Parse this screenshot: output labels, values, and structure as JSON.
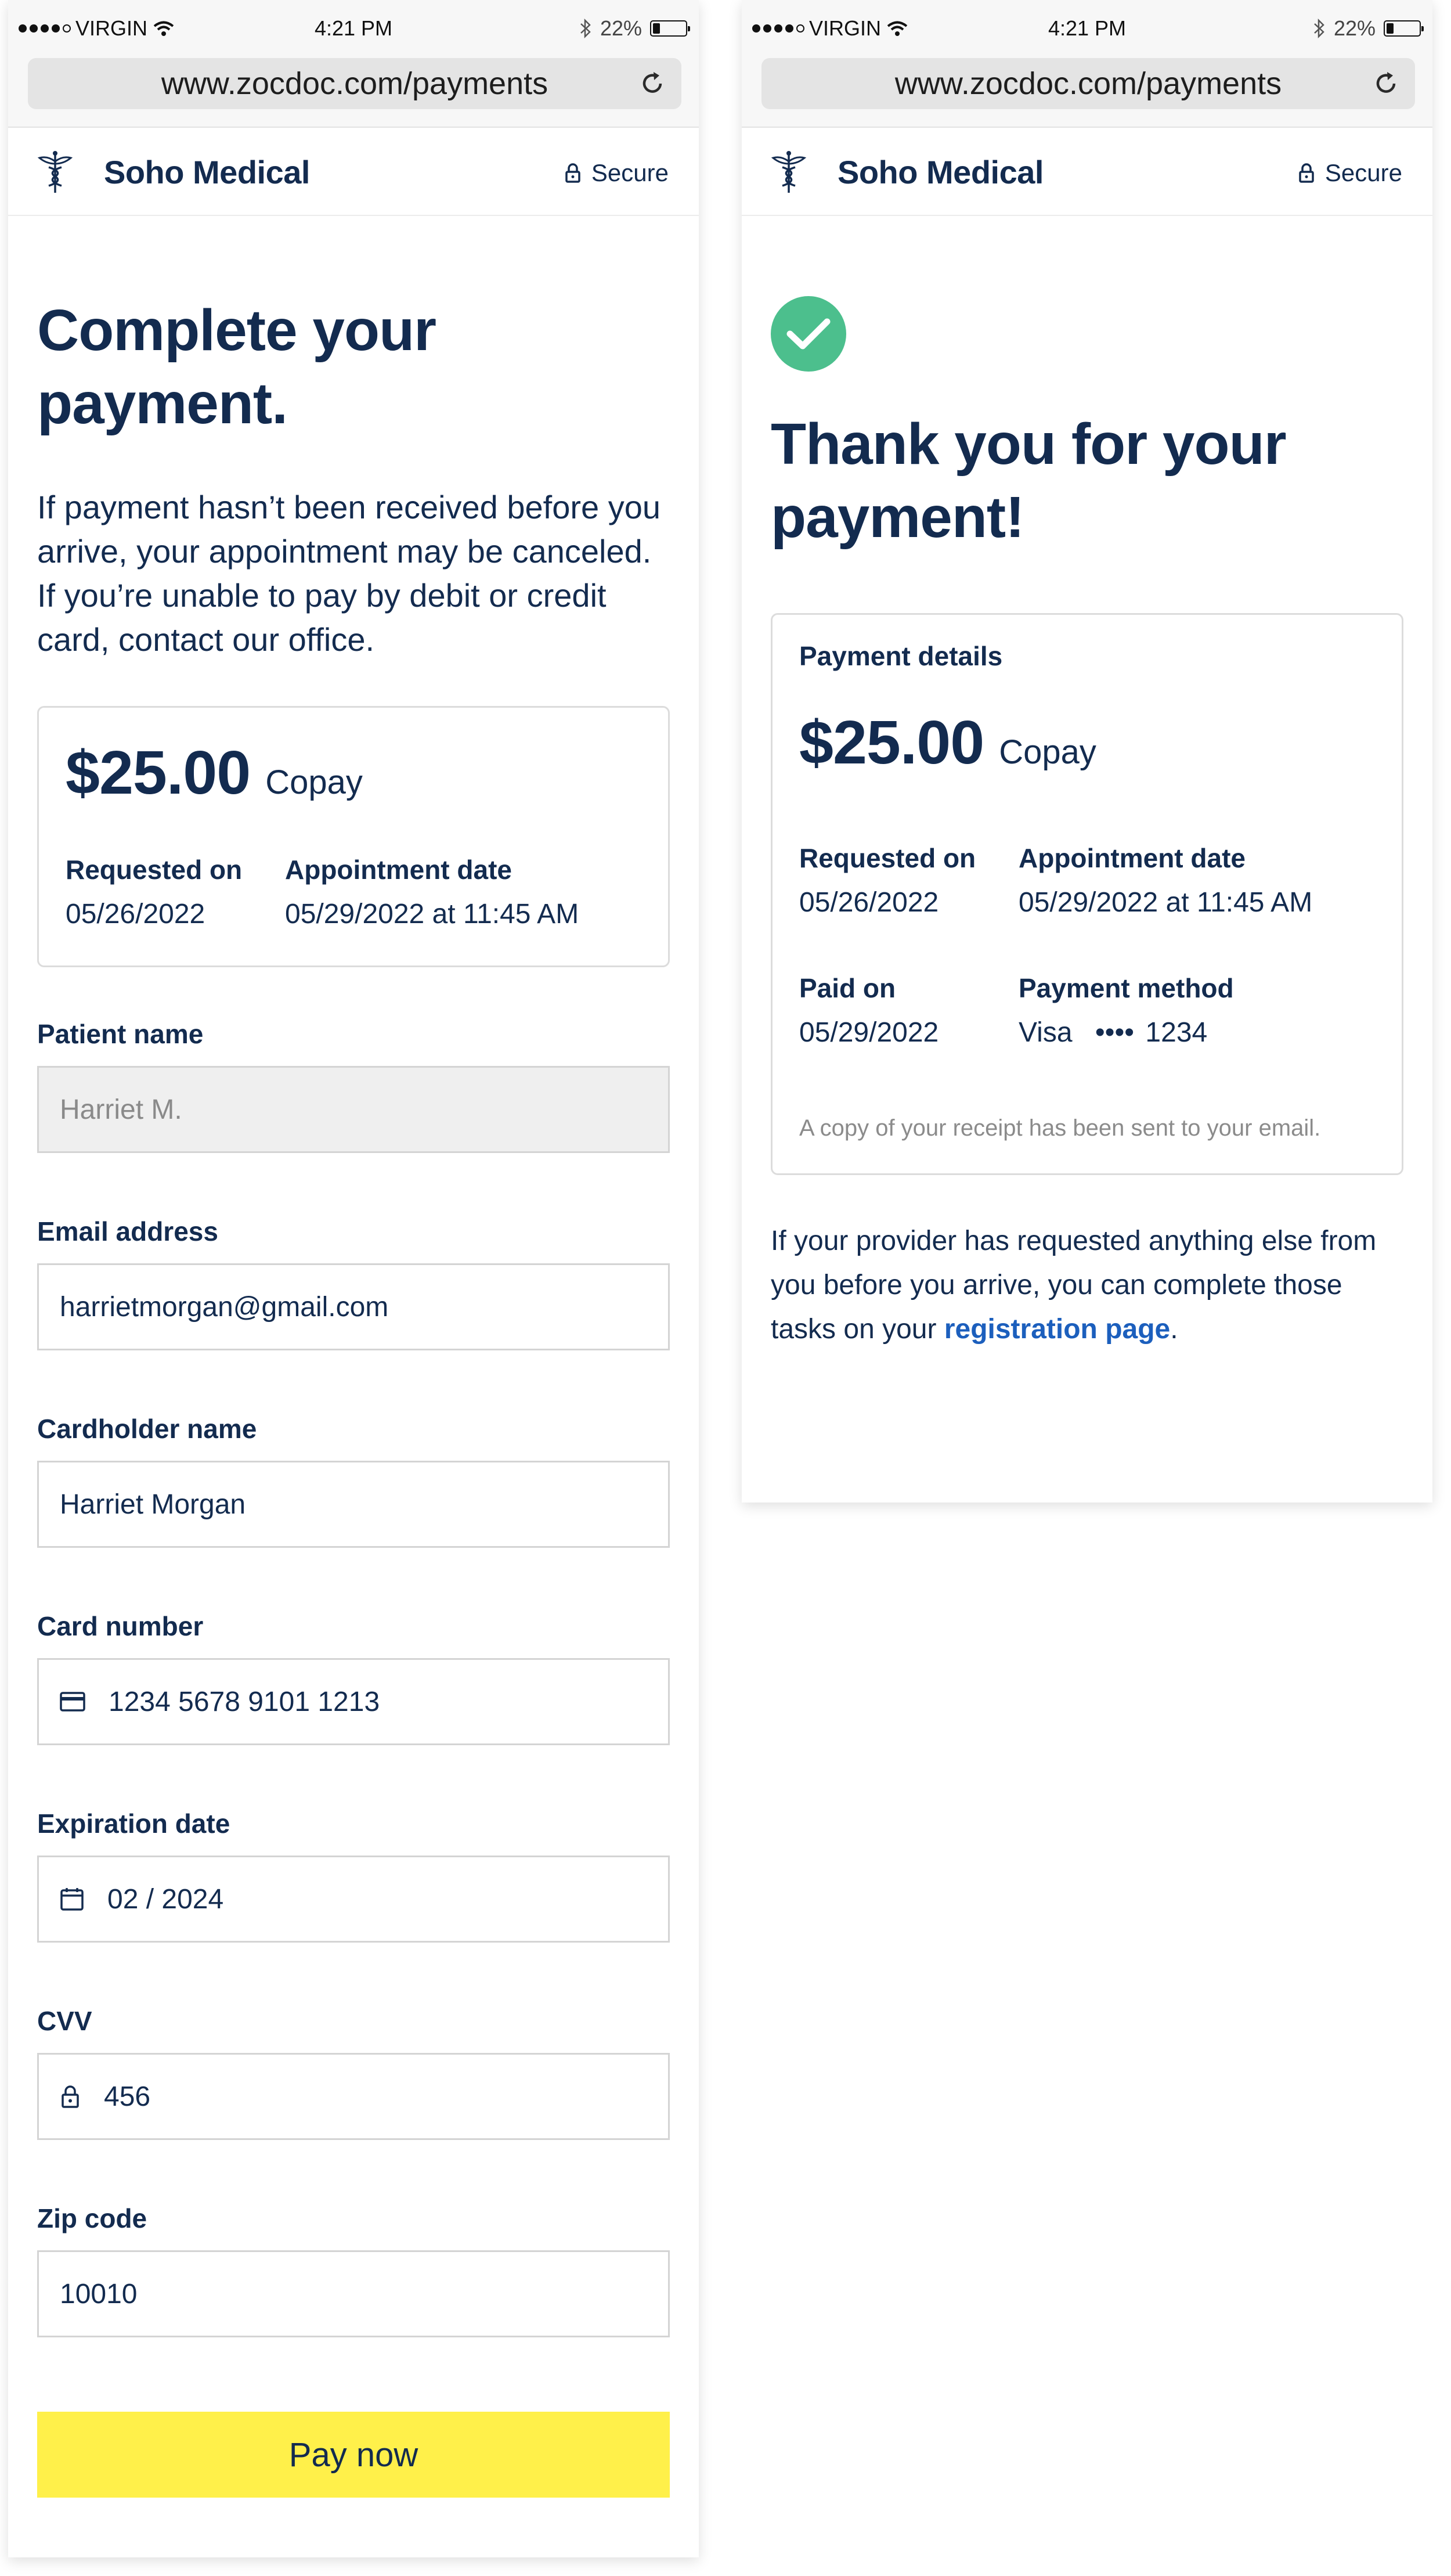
{
  "status_bar": {
    "carrier": "VIRGIN",
    "time": "4:21 PM",
    "battery": "22%"
  },
  "browser": {
    "url": "www.zocdoc.com/payments"
  },
  "header": {
    "brand": "Soho Medical",
    "secure_label": "Secure"
  },
  "payment_form": {
    "title": "Complete your payment.",
    "intro": "If payment hasn’t been received before you arrive, your appointment may be canceled. If you’re unable to pay by debit or credit card, contact our office.",
    "summary": {
      "amount": "$25.00",
      "amount_type": "Copay",
      "requested_label": "Requested on",
      "requested_value": "05/26/2022",
      "appointment_label": "Appointment date",
      "appointment_value": "05/29/2022 at 11:45 AM"
    },
    "fields": {
      "patient_name": {
        "label": "Patient name",
        "value": "Harriet M."
      },
      "email": {
        "label": "Email address",
        "value": "harrietmorgan@gmail.com"
      },
      "cardholder": {
        "label": "Cardholder name",
        "value": "Harriet Morgan"
      },
      "card_number": {
        "label": "Card number",
        "value": "1234 5678 9101 1213",
        "icon": "credit-card-icon"
      },
      "expiration": {
        "label": "Expiration date",
        "value": "02 / 2024",
        "icon": "calendar-icon"
      },
      "cvv": {
        "label": "CVV",
        "value": "456",
        "icon": "lock-icon"
      },
      "zip": {
        "label": "Zip code",
        "value": "10010"
      }
    },
    "pay_button": "Pay now"
  },
  "confirmation": {
    "title": "Thank you for your payment!",
    "details": {
      "heading": "Payment details",
      "amount": "$25.00",
      "amount_type": "Copay",
      "requested_label": "Requested on",
      "requested_value": "05/26/2022",
      "appointment_label": "Appointment date",
      "appointment_value": "05/29/2022 at 11:45 AM",
      "paid_label": "Paid on",
      "paid_value": "05/29/2022",
      "method_label": "Payment method",
      "method_brand": "Visa",
      "method_mask": "••••",
      "method_last4": "1234",
      "receipt_note": "A copy of your receipt has been sent to your email."
    },
    "followup_text": "If your provider has requested anything else from you before you arrive, you can complete those tasks on your",
    "followup_link": "registration page",
    "followup_end": "."
  },
  "colors": {
    "navy": "#132b4f",
    "pay_button": "#fff04a",
    "success_green": "#4cbf8d",
    "link_blue": "#1c5fbd"
  }
}
